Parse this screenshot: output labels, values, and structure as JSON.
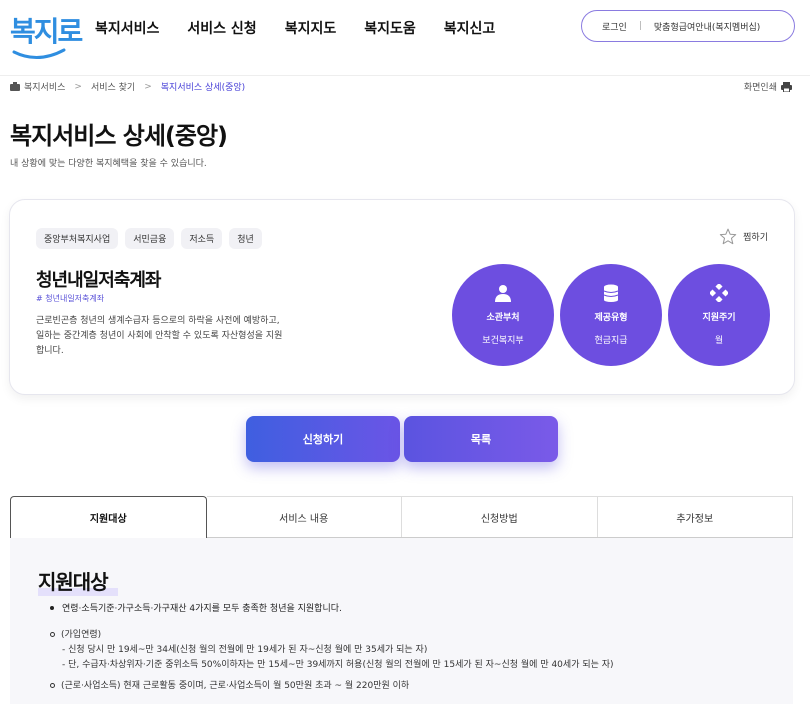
{
  "header": {
    "logo_text": "복지로",
    "nav": [
      "복지서비스",
      "서비스 신청",
      "복지지도",
      "복지도움",
      "복지신고"
    ],
    "login_label": "로그인",
    "guide_label": "맞춤형급여안내(복지멤버십)"
  },
  "breadcrumb": {
    "items": [
      "복지서비스",
      "서비스 찾기",
      "복지서비스 상세(중앙)"
    ],
    "print_label": "화면인쇄"
  },
  "page": {
    "title": "복지서비스 상세(중앙)",
    "description": "내 상황에 맞는 다양한 복지혜택을 찾을 수 있습니다."
  },
  "service": {
    "tags": [
      "중앙부처복지사업",
      "서민금융",
      "저소득",
      "청년"
    ],
    "favorite_label": "찜하기",
    "name": "청년내일저축계좌",
    "hashtag": "# 청년내일저축계좌",
    "description": "근로빈곤층 청년의 생계수급자 등으로의 하락을 사전에 예방하고, 일하는 중간계층 청년이 사회에 안착할 수 있도록 자산형성을 지원합니다.",
    "info": [
      {
        "label": "소관부처",
        "value": "보건복지부",
        "icon": "person-icon"
      },
      {
        "label": "제공유형",
        "value": "현금지급",
        "icon": "database-icon"
      },
      {
        "label": "지원주기",
        "value": "월",
        "icon": "diamond-dots-icon"
      }
    ]
  },
  "actions": {
    "apply_label": "신청하기",
    "list_label": "목록"
  },
  "tabs": [
    "지원대상",
    "서비스 내용",
    "신청방법",
    "추가정보"
  ],
  "content": {
    "title": "지원대상",
    "bullet": "연령·소득기준·가구소득·가구재산 4가지를 모두 충족한 청년을 지원합니다.",
    "sub1_title": "(가입연령)",
    "sub1_line1": "- 신청 당시 만 19세~만 34세(신청 월의 전월에 만 19세가 된 자~신청 월에 만 35세가 되는 자)",
    "sub1_line2": "- 단, 수급자·차상위자·기준 중위소득 50%이하자는 만 15세~만 39세까지 허용(신청 월의 전월에 만 15세가 된 자~신청 월에 만 40세가 되는 자)",
    "sub2": "(근로·사업소득) 현재 근로활동 중이며, 근로·사업소득이 월 50만원 초과 ~ 월 220만원 이하"
  },
  "colors": {
    "accent": "#6d4ee0",
    "link": "#4a43d8",
    "logo": "#2f8ee0"
  }
}
